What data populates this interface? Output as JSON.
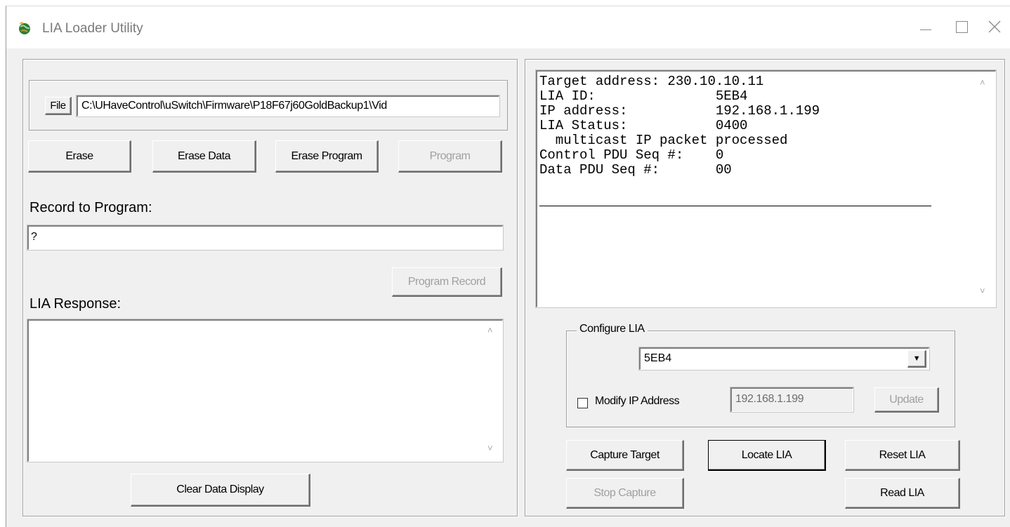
{
  "window": {
    "title": "LIA Loader Utility",
    "app_icon": "globe-icon"
  },
  "file": {
    "button_label": "File",
    "path": "C:\\UHaveControl\\uSwitch\\Firmware\\P18F67j60GoldBackup1\\Vid"
  },
  "actions": {
    "erase": "Erase",
    "erase_data": "Erase Data",
    "erase_program": "Erase Program",
    "program": "Program"
  },
  "record": {
    "label": "Record to Program:",
    "value": "?",
    "program_record": "Program Record"
  },
  "response": {
    "label": "LIA Response:",
    "content": "",
    "clear_button": "Clear Data Display"
  },
  "output": {
    "lines": [
      "Target address: 230.10.10.11",
      "LIA ID:               5EB4",
      "IP address:           192.168.1.199",
      "LIA Status:           0400",
      "  multicast IP packet processed",
      "Control PDU Seq #:    0",
      "Data PDU Seq #:       00"
    ]
  },
  "configure": {
    "group_title": "Configure LIA",
    "selected_id": "5EB4",
    "modify_ip_label": "Modify IP Address",
    "modify_ip_checked": false,
    "ip_value": "192.168.1.199",
    "update_button": "Update"
  },
  "controls": {
    "capture_target": "Capture Target",
    "locate_lia": "Locate LIA",
    "reset_lia": "Reset LIA",
    "stop_capture": "Stop Capture",
    "read_lia": "Read LIA"
  }
}
